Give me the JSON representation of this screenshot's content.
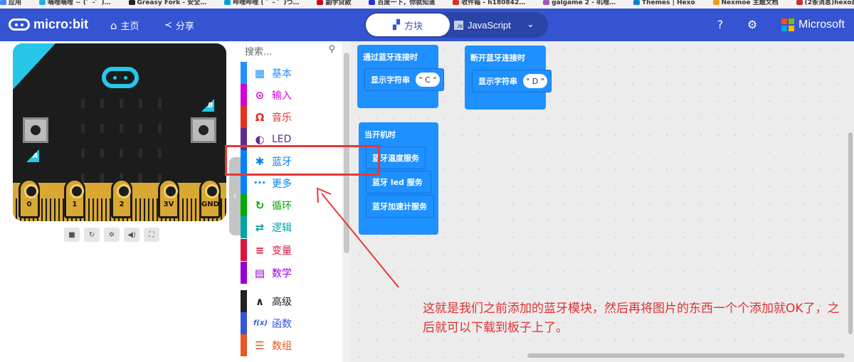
{
  "browser": {
    "bookmarks": [
      "应用",
      "嘀哩嘀哩 ~ (゜-゜)…",
      "Greasy Fork - 安全…",
      "哔哩哔哩 ( ゜- ゜)つ…",
      "副学贷款",
      "百度一下，你就知道",
      "收件箱 - h180842…",
      "galgame 2 - 叽哩…",
      "Themes | Hexo",
      "Nexmoe 主题文档",
      "(2条消息)hexo建立…",
      "»"
    ]
  },
  "header": {
    "logo_text": "micro:bit",
    "home_label": "主页",
    "share_label": "分享",
    "tab_blocks": "方块",
    "tab_js": "JavaScript",
    "js_badge": "JS",
    "microsoft": "Microsoft",
    "colors": {
      "bar": "#3454d1",
      "tabs": "#2a44a8"
    }
  },
  "simulator": {
    "label_a": "A",
    "label_b": "B",
    "pins": [
      "0",
      "1",
      "2",
      "3V",
      "GND"
    ],
    "tools": [
      "stop-icon",
      "restart-icon",
      "debug-icon",
      "sound-icon",
      "fullscreen-icon"
    ],
    "tool_glyphs": [
      "■",
      "↻",
      "✲",
      "◀)",
      "⛶"
    ]
  },
  "toolbox": {
    "search_placeholder": "搜索...",
    "categories": [
      {
        "label": "基本",
        "icon": "grid-icon",
        "glyph": "▦",
        "color": "#1e90ff"
      },
      {
        "label": "输入",
        "icon": "input-icon",
        "glyph": "⊙",
        "color": "#d400d4"
      },
      {
        "label": "音乐",
        "icon": "headphones-icon",
        "glyph": "Ω",
        "color": "#e63022"
      },
      {
        "label": "LED",
        "icon": "toggle-icon",
        "glyph": "◐",
        "color": "#5c2d91"
      },
      {
        "label": "蓝牙",
        "icon": "bluetooth-icon",
        "glyph": "✱",
        "color": "#0082fb"
      },
      {
        "label": "更多",
        "icon": "more-icon",
        "glyph": "•••",
        "color": "#0082fb"
      },
      {
        "label": "循环",
        "icon": "loop-icon",
        "glyph": "↻",
        "color": "#00aa00"
      },
      {
        "label": "逻辑",
        "icon": "shuffle-icon",
        "glyph": "⇄",
        "color": "#00a4a6"
      },
      {
        "label": "变量",
        "icon": "lines-icon",
        "glyph": "≡",
        "color": "#dc143c"
      },
      {
        "label": "数学",
        "icon": "calculator-icon",
        "glyph": "▤",
        "color": "#9400d3"
      },
      {
        "label": "高级",
        "icon": "chevron-up-icon",
        "glyph": "∧",
        "color": "#222222"
      },
      {
        "label": "函数",
        "icon": "function-icon",
        "glyph": "f(x)",
        "color": "#3455db"
      },
      {
        "label": "数组",
        "icon": "list-icon",
        "glyph": "☰",
        "color": "#e65722"
      }
    ]
  },
  "workspace": {
    "block_connected": {
      "title": "通过蓝牙连接时",
      "stmt": "显示字符串",
      "value": "\" C \""
    },
    "block_disconnected": {
      "title": "断开蓝牙连接时",
      "stmt": "显示字符串",
      "value": "\" D \""
    },
    "block_start": {
      "title": "当开机时",
      "stmts": [
        "蓝牙温度服务",
        "蓝牙 led 服务",
        "蓝牙加速计服务"
      ]
    },
    "block_color": "#1e90ff"
  },
  "annotation": {
    "text": "这就是我们之前添加的蓝牙模块，然后再将图片的东西一个个添加就OK了，之后就可以下载到板子上了。",
    "color": "#e03131"
  }
}
